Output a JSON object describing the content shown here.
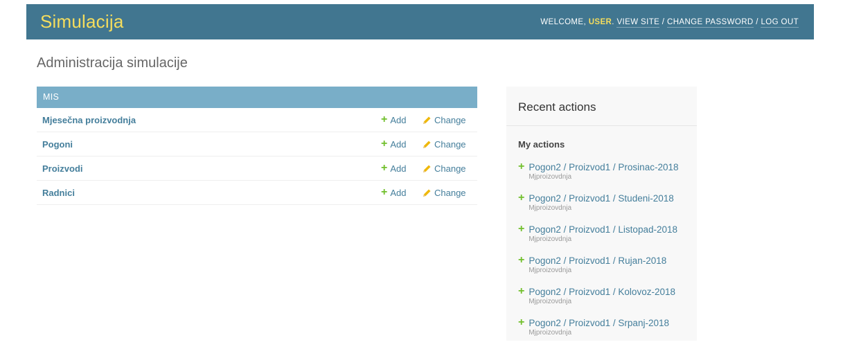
{
  "header": {
    "branding": "Simulacija",
    "welcome_prefix": "WELCOME, ",
    "username": "USER",
    "welcome_suffix": ". ",
    "view_site": "VIEW SITE",
    "separator": " / ",
    "change_password": "CHANGE PASSWORD",
    "log_out": "LOG OUT"
  },
  "page_title": "Administracija simulacije",
  "module": {
    "caption": "MIS",
    "add_label": "Add",
    "change_label": "Change",
    "models": [
      {
        "name": "Mjesečna proizvodnja"
      },
      {
        "name": "Pogoni"
      },
      {
        "name": "Proizvodi"
      },
      {
        "name": "Radnici"
      }
    ]
  },
  "recent": {
    "title": "Recent actions",
    "my_actions_title": "My actions",
    "items": [
      {
        "label": "Pogon2 / Proizvod1 / Prosinac-2018",
        "type": "Mjproizovdnja"
      },
      {
        "label": "Pogon2 / Proizvod1 / Studeni-2018",
        "type": "Mjproizovdnja"
      },
      {
        "label": "Pogon2 / Proizvod1 / Listopad-2018",
        "type": "Mjproizovdnja"
      },
      {
        "label": "Pogon2 / Proizvod1 / Rujan-2018",
        "type": "Mjproizovdnja"
      },
      {
        "label": "Pogon2 / Proizvod1 / Kolovoz-2018",
        "type": "Mjproizovdnja"
      },
      {
        "label": "Pogon2 / Proizvod1 / Srpanj-2018",
        "type": "Mjproizovdnja"
      }
    ]
  },
  "colors": {
    "header_bg": "#417690",
    "branding": "#f5dd5d",
    "caption_bg": "#79aec8",
    "link": "#447e9b",
    "add_icon": "#70bf2b",
    "change_icon": "#efb80b"
  },
  "icons": {
    "add": "plus-icon",
    "change": "pencil-icon"
  }
}
